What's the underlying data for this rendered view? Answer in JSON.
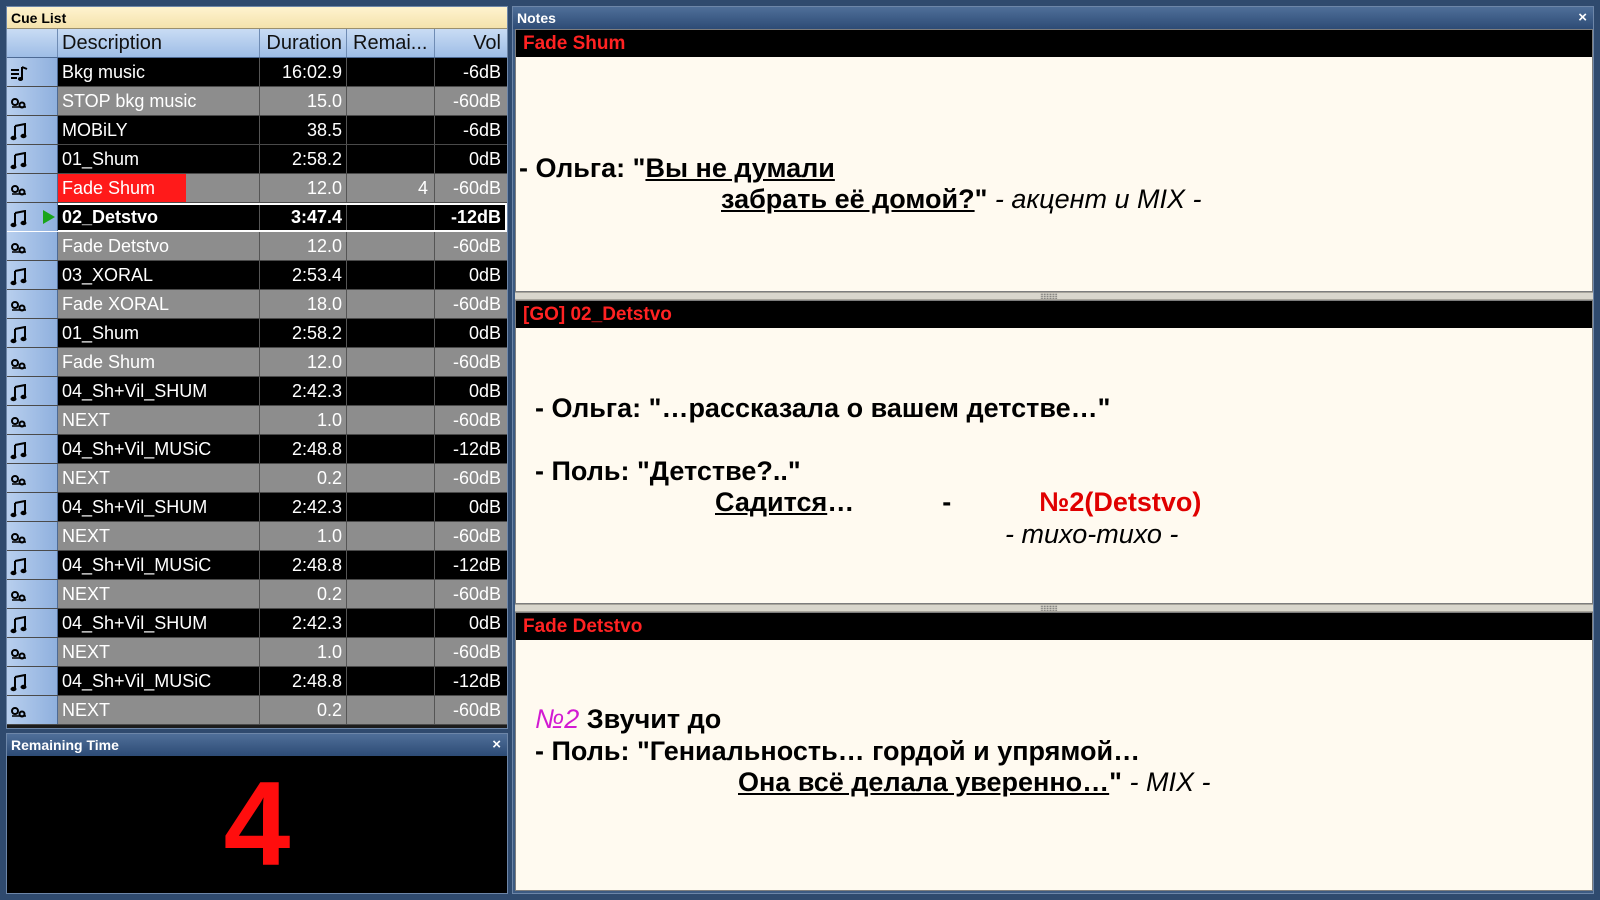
{
  "cue_list": {
    "title": "Cue List",
    "columns": [
      "Description",
      "Duration",
      "Remai...",
      "Vol"
    ],
    "rows": [
      {
        "type": "playlist",
        "icon": "playlist-icon",
        "description": "Bkg music",
        "duration": "16:02.9",
        "remaining": "",
        "vol": "-6dB"
      },
      {
        "type": "fade",
        "icon": "fade-icon",
        "description": "STOP bkg music",
        "duration": "15.0",
        "remaining": "",
        "vol": "-60dB"
      },
      {
        "type": "audio",
        "icon": "music-note-icon",
        "description": "MOBiLY",
        "duration": "38.5",
        "remaining": "",
        "vol": "-6dB"
      },
      {
        "type": "audio",
        "icon": "music-note-icon",
        "description": "01_Shum",
        "duration": "2:58.2",
        "remaining": "",
        "vol": "0dB"
      },
      {
        "type": "fade",
        "icon": "fade-icon",
        "description": "Fade Shum",
        "duration": "12.0",
        "remaining": "4",
        "vol": "-60dB",
        "running": true
      },
      {
        "type": "audio",
        "icon": "music-note-icon",
        "description": "02_Detstvo",
        "duration": "3:47.4",
        "remaining": "",
        "vol": "-12dB",
        "selected": true
      },
      {
        "type": "fade",
        "icon": "fade-icon",
        "description": "Fade Detstvo",
        "duration": "12.0",
        "remaining": "",
        "vol": "-60dB"
      },
      {
        "type": "audio",
        "icon": "music-note-icon",
        "description": "03_XORAL",
        "duration": "2:53.4",
        "remaining": "",
        "vol": "0dB"
      },
      {
        "type": "fade",
        "icon": "fade-icon",
        "description": "Fade XORAL",
        "duration": "18.0",
        "remaining": "",
        "vol": "-60dB"
      },
      {
        "type": "audio",
        "icon": "music-note-icon",
        "description": "01_Shum",
        "duration": "2:58.2",
        "remaining": "",
        "vol": "0dB"
      },
      {
        "type": "fade",
        "icon": "fade-icon",
        "description": "Fade Shum",
        "duration": "12.0",
        "remaining": "",
        "vol": "-60dB"
      },
      {
        "type": "audio",
        "icon": "music-note-icon",
        "description": "04_Sh+Vil_SHUM",
        "duration": "2:42.3",
        "remaining": "",
        "vol": "0dB"
      },
      {
        "type": "fade",
        "icon": "fade-icon",
        "description": "NEXT",
        "duration": "1.0",
        "remaining": "",
        "vol": "-60dB"
      },
      {
        "type": "audio",
        "icon": "music-note-icon",
        "description": "04_Sh+Vil_MUSiC",
        "duration": "2:48.8",
        "remaining": "",
        "vol": "-12dB"
      },
      {
        "type": "fade",
        "icon": "fade-icon",
        "description": "NEXT",
        "duration": "0.2",
        "remaining": "",
        "vol": "-60dB"
      },
      {
        "type": "audio",
        "icon": "music-note-icon",
        "description": "04_Sh+Vil_SHUM",
        "duration": "2:42.3",
        "remaining": "",
        "vol": "0dB"
      },
      {
        "type": "fade",
        "icon": "fade-icon",
        "description": "NEXT",
        "duration": "1.0",
        "remaining": "",
        "vol": "-60dB"
      },
      {
        "type": "audio",
        "icon": "music-note-icon",
        "description": "04_Sh+Vil_MUSiC",
        "duration": "2:48.8",
        "remaining": "",
        "vol": "-12dB"
      },
      {
        "type": "fade",
        "icon": "fade-icon",
        "description": "NEXT",
        "duration": "0.2",
        "remaining": "",
        "vol": "-60dB"
      },
      {
        "type": "audio",
        "icon": "music-note-icon",
        "description": "04_Sh+Vil_SHUM",
        "duration": "2:42.3",
        "remaining": "",
        "vol": "0dB"
      },
      {
        "type": "fade",
        "icon": "fade-icon",
        "description": "NEXT",
        "duration": "1.0",
        "remaining": "",
        "vol": "-60dB"
      },
      {
        "type": "audio",
        "icon": "music-note-icon",
        "description": "04_Sh+Vil_MUSiC",
        "duration": "2:48.8",
        "remaining": "",
        "vol": "-12dB"
      },
      {
        "type": "fade",
        "icon": "fade-icon",
        "description": "NEXT",
        "duration": "0.2",
        "remaining": "",
        "vol": "-60dB"
      }
    ]
  },
  "remaining_time": {
    "title": "Remaining Time",
    "close_glyph": "×",
    "value": "4",
    "value_color": "#ff0d0d"
  },
  "notes": {
    "title": "Notes",
    "close_glyph": "×",
    "sections": [
      {
        "heading": "Fade Shum",
        "lines": [
          [
            {
              "t": "- Ольга: \"",
              "b": true
            },
            {
              "t": "Вы не думали",
              "b": true,
              "u": true
            }
          ],
          [
            {
              "t": "забрать её домой?",
              "b": true,
              "u": true
            },
            {
              "t": "\"",
              "b": true
            },
            {
              "t": "   - акцент и MIX -",
              "i": true
            }
          ]
        ]
      },
      {
        "heading": "[GO] 02_Detstvo",
        "lines": [
          [
            {
              "t": "- Ольга: \"…рассказала о вашем детстве…\"",
              "b": true
            }
          ],
          [
            {
              "t": "- Поль: \"Детстве?..\"",
              "b": true
            }
          ],
          [
            {
              "t": "Садится",
              "b": true,
              "u": true
            },
            {
              "t": "…",
              "b": true
            },
            {
              "t": "-",
              "b": true,
              "gap": true
            },
            {
              "t": "№2(Detstvo)",
              "red": true,
              "gap": true
            }
          ],
          [
            {
              "t": "- тихо-тихо -",
              "i": true
            }
          ]
        ]
      },
      {
        "heading": "Fade Detstvo",
        "lines": [
          [
            {
              "t": "№2",
              "mag": true
            },
            {
              "t": " Звучит до",
              "b": true
            }
          ],
          [
            {
              "t": "- Поль: \"Гениальность… гордой и упрямой…",
              "b": true
            }
          ],
          [
            {
              "t": "Она всё делала уверенно…",
              "b": true,
              "u": true
            },
            {
              "t": "\"",
              "b": true
            },
            {
              "t": "   - MIX -",
              "i": true
            }
          ]
        ]
      }
    ]
  },
  "colors": {
    "audio_row": "#000000",
    "fade_row": "#8d8d8d",
    "running_highlight": "#ff1a1a",
    "play_indicator": "#1aa51a",
    "note_heading_text": "#ff2222",
    "note_red": "#e00000",
    "note_magenta": "#d21ad2"
  }
}
